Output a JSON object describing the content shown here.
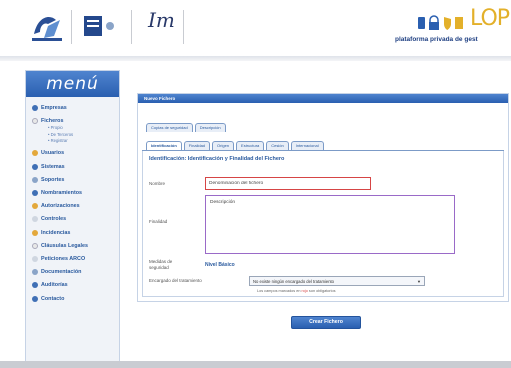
{
  "header": {
    "logo1_caption": "",
    "logo2_caption": "",
    "logo3_text": "Im",
    "brand_text": "LOP",
    "brand_subtitle": "plataforma privada de gest"
  },
  "sidebar": {
    "title": "menú",
    "items": [
      {
        "label": "Empresas",
        "icon": "building-icon",
        "color": "#3f6fb5"
      },
      {
        "label": "Ficheros",
        "icon": "folder-icon",
        "color": "#e8e8e8"
      },
      {
        "label": "Usuarios",
        "icon": "users-icon",
        "color": "#e3a83b"
      },
      {
        "label": "Sistemas",
        "icon": "monitor-icon",
        "color": "#3f6fb5"
      },
      {
        "label": "Soportes",
        "icon": "disk-icon",
        "color": "#8aa4c8"
      },
      {
        "label": "Nombramientos",
        "icon": "user-badge-icon",
        "color": "#3f6fb5"
      },
      {
        "label": "Autorizaciones",
        "icon": "key-icon",
        "color": "#e3a83b"
      },
      {
        "label": "Controles",
        "icon": "check-icon",
        "color": "#cfd6e0"
      },
      {
        "label": "Incidencias",
        "icon": "warning-icon",
        "color": "#e3a83b"
      },
      {
        "label": "Cláusulas Legales",
        "icon": "document-icon",
        "color": "#e8e8e8"
      },
      {
        "label": "Peticiones ARCO",
        "icon": "request-icon",
        "color": "#cfd6e0"
      },
      {
        "label": "Documentación",
        "icon": "docs-icon",
        "color": "#8aa4c8"
      },
      {
        "label": "Auditorías",
        "icon": "audit-icon",
        "color": "#3f6fb5"
      },
      {
        "label": "Contacto",
        "icon": "contact-icon",
        "color": "#3f6fb5"
      }
    ],
    "subitems": [
      "Propio",
      "De Terceros",
      "Registrar"
    ]
  },
  "panel": {
    "title": "Nuevo Fichero",
    "tabs_row1": [
      "Copias de seguridad",
      "Descripción"
    ],
    "tabs_row2": [
      "Identificación",
      "Finalidad",
      "Origen",
      "Estructura",
      "Cesión",
      "Internacional"
    ],
    "section_title": "Identificación: Identificación y Finalidad del Fichero",
    "nombre_label": "Nombre",
    "nombre_value": "Denominación del fichero",
    "finalidad_label": "Finalidad",
    "finalidad_value": "Descripción",
    "security_label": "Medidas de seguridad",
    "security_value": "Nivel Básico",
    "encargado_label": "Encargado del tratamiento",
    "encargado_value": "No existe ningún encargado del tratamiento",
    "required_note_pre": "Los campos marcados en ",
    "required_note_red": "rojo",
    "required_note_post": " son obligatorios"
  },
  "actions": {
    "create_label": "Crear Fichero"
  },
  "colors": {
    "accent": "#2a5fb0",
    "brand": "#e3b02a",
    "required": "#d64545"
  }
}
